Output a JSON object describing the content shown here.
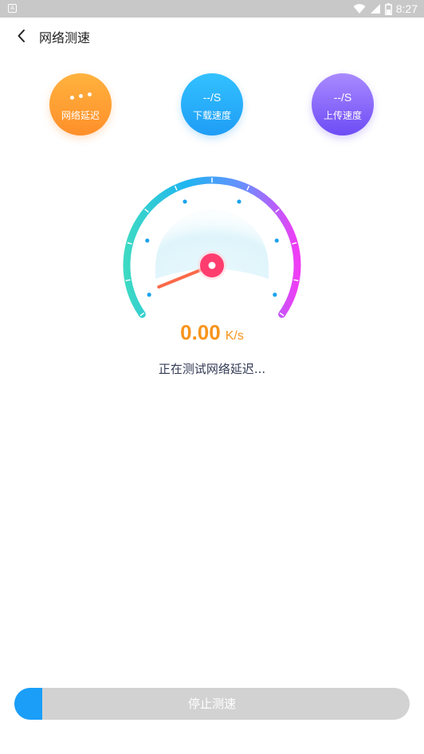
{
  "status_bar": {
    "time": "8:27",
    "icons": [
      "notification-icon",
      "wifi-icon",
      "signal-icon",
      "battery-icon"
    ]
  },
  "header": {
    "title": "网络测速",
    "back_icon": "chevron-left-icon"
  },
  "metrics": [
    {
      "id": "latency",
      "value": "",
      "label": "网络延迟",
      "color": "#ff9a30"
    },
    {
      "id": "download",
      "value": "--/S",
      "label": "下载速度",
      "color": "#22a8f8"
    },
    {
      "id": "upload",
      "value": "--/S",
      "label": "上传速度",
      "color": "#7b5bf7"
    }
  ],
  "gauge": {
    "needle_level": 0.0,
    "gradient": [
      "#3dd9c4",
      "#1fb5f0",
      "#6f8bff",
      "#f03cf5"
    ],
    "needle_color": "#ff3d6e"
  },
  "speed": {
    "value": "0.00",
    "unit": "K/s"
  },
  "status": {
    "text": "正在测试网络延迟..."
  },
  "stop_button": {
    "label": "停止测速",
    "progress": 0.07,
    "progress_color": "#1a9ef8"
  }
}
